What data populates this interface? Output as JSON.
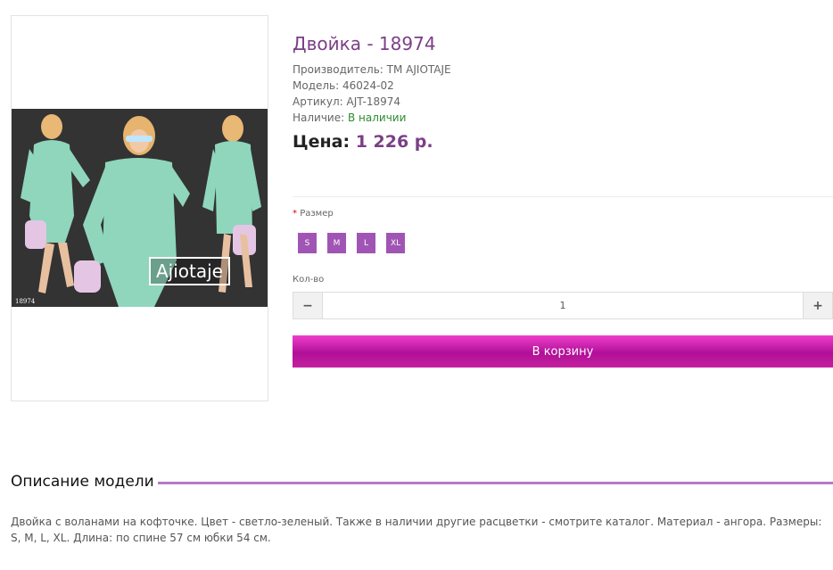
{
  "product": {
    "title": "Двойка - 18974",
    "image_logo_text": "Ajiotaje",
    "image_article_mark": "18974",
    "manufacturer_label": "Производитель:",
    "manufacturer_value": "ТМ AJIOTAJE",
    "model_label": "Модель:",
    "model_value": "46024-02",
    "sku_label": "Артикул:",
    "sku_value": "AJT-18974",
    "availability_label": "Наличие:",
    "availability_value": "В наличии",
    "price_label": "Цена:",
    "price_value": "1 226 р."
  },
  "options": {
    "required_mark": "*",
    "size_label": "Размер",
    "sizes": [
      "S",
      "M",
      "L",
      "XL"
    ],
    "size_color": "#a055b4"
  },
  "quantity": {
    "label": "Кол-во",
    "minus": "−",
    "value": "1",
    "plus": "+"
  },
  "cart": {
    "button_label": "В корзину",
    "color": "#c4219f"
  },
  "description": {
    "title": "Описание модели",
    "text": "Двойка с воланами на кофточке. Цвет - светло-зеленый. Также в наличии другие расцветки - смотрите каталог. Материал - ангора. Размеры: S, M, L, XL. Длина: по спине 57 см юбки 54 см."
  }
}
